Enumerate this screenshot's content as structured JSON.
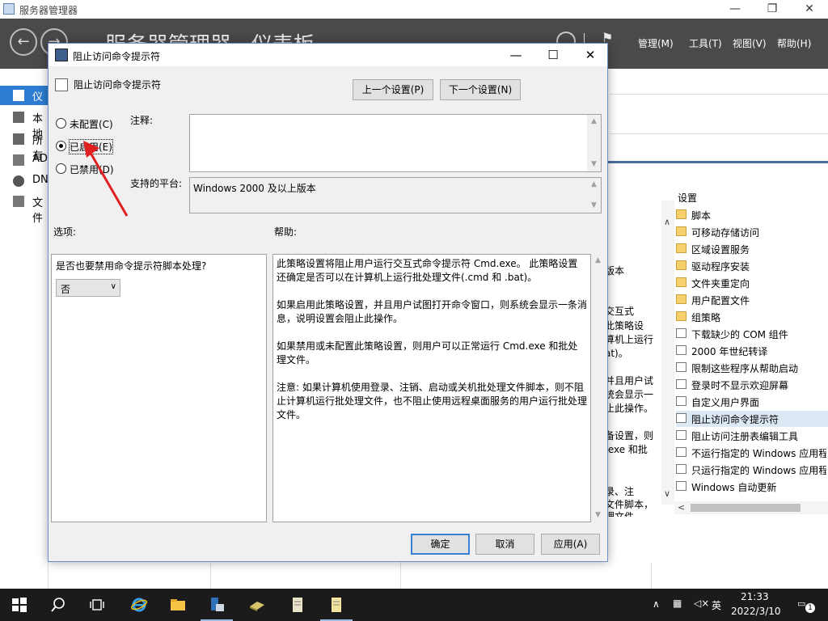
{
  "server_manager": {
    "window_title": "服务器管理器",
    "window_controls": {
      "minimize": "—",
      "restore": "❐",
      "close": "✕"
    },
    "nav_back": "←",
    "nav_forward": "→",
    "breadcrumb": "服务器管理器 · 仪表板",
    "menus": [
      "管理(M)",
      "工具(T)",
      "视图(V)",
      "帮助(H)"
    ],
    "nav_items": [
      {
        "label": "仪表",
        "active": true
      },
      {
        "label": "本地"
      },
      {
        "label": "所有"
      },
      {
        "label": "AD"
      },
      {
        "label": "DN"
      },
      {
        "label": "文件"
      }
    ]
  },
  "gpe_background": {
    "description_fragments": [
      "版本",
      "交互式",
      "此策略设",
      "算机上运行",
      "at)。",
      "并且用户试",
      "统会显示一",
      "止此操作。",
      "备设置，则",
      ".exe 和批",
      "录、注",
      "文件脚本，",
      "理文件"
    ],
    "settings_header": "设置",
    "settings": [
      {
        "label": "脚本",
        "type": "folder"
      },
      {
        "label": "可移动存储访问",
        "type": "folder"
      },
      {
        "label": "区域设置服务",
        "type": "folder"
      },
      {
        "label": "驱动程序安装",
        "type": "folder"
      },
      {
        "label": "文件夹重定向",
        "type": "folder"
      },
      {
        "label": "用户配置文件",
        "type": "folder"
      },
      {
        "label": "组策略",
        "type": "folder"
      },
      {
        "label": "下载缺少的 COM 组件",
        "type": "policy"
      },
      {
        "label": "2000 年世纪转译",
        "type": "policy"
      },
      {
        "label": "限制这些程序从帮助启动",
        "type": "policy"
      },
      {
        "label": "登录时不显示欢迎屏幕",
        "type": "policy"
      },
      {
        "label": "自定义用户界面",
        "type": "policy"
      },
      {
        "label": "阻止访问命令提示符",
        "type": "policy",
        "selected": true
      },
      {
        "label": "阻止访问注册表编辑工具",
        "type": "policy"
      },
      {
        "label": "不运行指定的 Windows 应用程",
        "type": "policy"
      },
      {
        "label": "只运行指定的 Windows 应用程",
        "type": "policy"
      },
      {
        "label": "Windows 自动更新",
        "type": "policy"
      }
    ]
  },
  "dialog": {
    "title": "阻止访问命令提示符",
    "controls": {
      "minimize": "—",
      "maximize": "☐",
      "close": "✕"
    },
    "policy_name": "阻止访问命令提示符",
    "prev_button": "上一个设置(P)",
    "next_button": "下一个设置(N)",
    "radio_options": [
      {
        "label": "未配置(C)",
        "checked": false
      },
      {
        "label": "已启用(E)",
        "checked": true
      },
      {
        "label": "已禁用(D)",
        "checked": false
      }
    ],
    "comment_label": "注释:",
    "comment_value": "",
    "platform_label": "支持的平台:",
    "platform_value": "Windows 2000 及以上版本",
    "options_label": "选项:",
    "help_label": "帮助:",
    "option_question": "是否也要禁用命令提示符脚本处理?",
    "option_select_value": "否",
    "help_paragraphs": [
      "此策略设置将阻止用户运行交互式命令提示符 Cmd.exe。 此策略设置还确定是否可以在计算机上运行批处理文件(.cmd 和 .bat)。",
      "如果启用此策略设置，并且用户试图打开命令窗口，则系统会显示一条消息，说明设置会阻止此操作。",
      "如果禁用或未配置此策略设置，则用户可以正常运行 Cmd.exe 和批处理文件。",
      "注意: 如果计算机使用登录、注销、启动或关机批处理文件脚本，则不阻止计算机运行批处理文件，也不阻止使用远程桌面服务的用户运行批处理文件。"
    ],
    "ok_button": "确定",
    "cancel_button": "取消",
    "apply_button": "应用(A)"
  },
  "annotation": {
    "color": "#e02020"
  },
  "taskbar": {
    "items": [
      "start",
      "search",
      "task-view",
      "internet-explorer",
      "file-explorer",
      "server-manager",
      "toolbox",
      "notepad-1",
      "notepad-2"
    ],
    "tray": {
      "language": "英",
      "time": "21:33",
      "date": "2022/3/10",
      "notifications": "1"
    }
  },
  "colors": {
    "accent": "#2d7dd2",
    "header_bg": "#4a4a4a",
    "taskbar_bg": "#1b1b1b",
    "dialog_border": "#6b91c9"
  }
}
